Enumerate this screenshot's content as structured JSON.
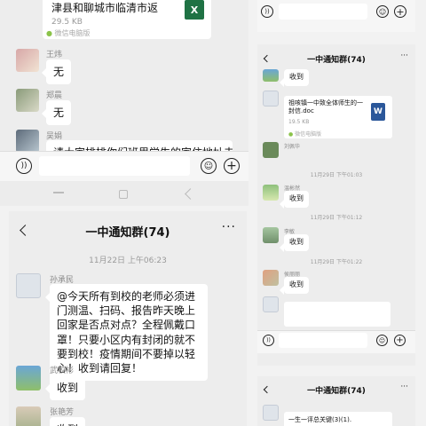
{
  "panel_tl": {
    "file_title_tail": "津县和聊城市临清市返",
    "file_size": "29.5 KB",
    "file_source": "微信电脑版",
    "messages": [
      {
        "name": "王炜",
        "text": "无"
      },
      {
        "name": "郑晨",
        "text": "无"
      },
      {
        "name": "吴娟",
        "text": "请大家排排你们班里学生的家住地址去没有去上去过"
      }
    ]
  },
  "panel_bl": {
    "title": "一中通知群(74)",
    "timestamp": "11月22日 上午06:23",
    "messages": [
      {
        "name": "孙承民",
        "text": "@今天所有到校的老师必须进门测温、扫码、报告昨天晚上回家是否点对点？全程佩戴口罩！只要小区内有封闭的就不要到校！疫情期间不要掉以轻心！收到请回复！"
      },
      {
        "name": "武校彬",
        "text": "收到"
      },
      {
        "name": "张艳芳",
        "text": "收到"
      }
    ]
  },
  "panel_tr": {
    "note": ""
  },
  "panel_mr": {
    "title": "一中通知群(74)",
    "first_msg": "收到",
    "file_title": "祖咳镇一中致全体师生的一封信.doc",
    "file_size": "19.5 KB",
    "file_source": "微信电脑版",
    "names": [
      "刘佩华",
      "温彬然",
      "李敏",
      "侯丽丽"
    ],
    "times": [
      "11月29日 下午01:03",
      "11月29日 下午01:12",
      "11月29日 下午01:22"
    ],
    "replies": [
      "收到",
      "收到",
      "收到"
    ]
  },
  "panel_br": {
    "title": "一中通知群(74)",
    "file_title": "一生一评总关键(3)(1)."
  },
  "colors": {
    "bg": "#ededed",
    "bubble": "#ffffff",
    "excel": "#1f7244",
    "word": "#2b579a"
  }
}
